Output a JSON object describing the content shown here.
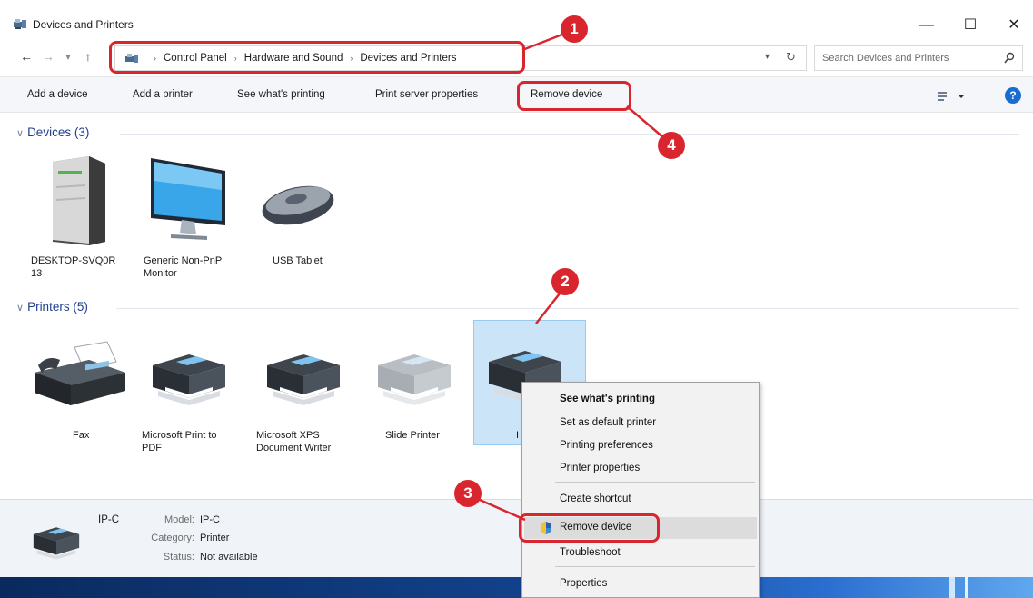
{
  "window": {
    "title": "Devices and Printers",
    "controls": {
      "minimize": "—",
      "maximize": "☐",
      "close": "✕"
    }
  },
  "address": {
    "breadcrumb": [
      "Control Panel",
      "Hardware and Sound",
      "Devices and Printers"
    ],
    "separator": "›",
    "search_placeholder": "Search Devices and Printers"
  },
  "commands": {
    "add_device": "Add a device",
    "add_printer": "Add a printer",
    "see_printing": "See what's printing",
    "print_server": "Print server properties",
    "remove_device": "Remove device",
    "help": "?"
  },
  "devices": {
    "header": "Devices (3)",
    "items": [
      {
        "label_line1": "DESKTOP-SVQ0R",
        "label_line2": "13",
        "icon": "computer-tower-icon"
      },
      {
        "label_line1": "Generic Non-PnP",
        "label_line2": "Monitor",
        "icon": "monitor-icon"
      },
      {
        "label_line1": "USB Tablet",
        "label_line2": "",
        "icon": "mouse-icon"
      }
    ]
  },
  "printers": {
    "header": "Printers (5)",
    "items": [
      {
        "label_line1": "Fax",
        "label_line2": "",
        "icon": "fax-icon"
      },
      {
        "label_line1": "Microsoft Print to",
        "label_line2": "PDF",
        "icon": "printer-icon"
      },
      {
        "label_line1": "Microsoft XPS",
        "label_line2": "Document Writer",
        "icon": "printer-icon"
      },
      {
        "label_line1": "Slide Printer",
        "label_line2": "",
        "icon": "printer-gray-icon"
      },
      {
        "label_line1": "I",
        "label_line2": "",
        "icon": "printer-icon",
        "selected": true
      }
    ]
  },
  "details": {
    "name": "IP-C",
    "model_key": "Model:",
    "model_val": "IP-C",
    "category_key": "Category:",
    "category_val": "Printer",
    "status_key": "Status:",
    "status_val": "Not available"
  },
  "context_menu": {
    "see_printing": "See what's printing",
    "set_default": "Set as default printer",
    "printing_prefs": "Printing preferences",
    "printer_props": "Printer properties",
    "create_shortcut": "Create shortcut",
    "remove_device": "Remove device",
    "troubleshoot": "Troubleshoot",
    "properties": "Properties"
  },
  "annotations": [
    "1",
    "2",
    "3",
    "4"
  ],
  "colors": {
    "annotation_red": "#d9262e",
    "group_header_blue": "#1e3f8a",
    "selection_blue": "#cce4f7",
    "help_blue": "#1a6dd0"
  }
}
